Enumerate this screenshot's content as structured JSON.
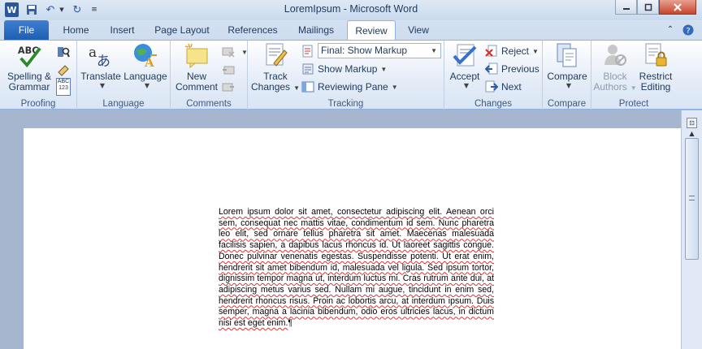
{
  "window": {
    "title": "LoremIpsum - Microsoft Word",
    "app_icon": "W"
  },
  "tabs": [
    {
      "label": "File"
    },
    {
      "label": "Home"
    },
    {
      "label": "Insert"
    },
    {
      "label": "Page Layout"
    },
    {
      "label": "References"
    },
    {
      "label": "Mailings"
    },
    {
      "label": "Review"
    },
    {
      "label": "View"
    }
  ],
  "active_tab": "Review",
  "ribbon": {
    "proofing": {
      "label": "Proofing",
      "spelling_line1": "Spelling &",
      "spelling_line2": "Grammar",
      "abc_small": "ABC",
      "num_small": "123"
    },
    "language": {
      "label": "Language",
      "translate": "Translate",
      "language": "Language"
    },
    "comments": {
      "label": "Comments",
      "new_comment_line1": "New",
      "new_comment_line2": "Comment"
    },
    "tracking": {
      "label": "Tracking",
      "track_changes_line1": "Track",
      "track_changes_line2": "Changes",
      "markup_select": "Final: Show Markup",
      "show_markup": "Show Markup",
      "reviewing_pane": "Reviewing Pane"
    },
    "changes": {
      "label": "Changes",
      "accept": "Accept",
      "reject": "Reject",
      "previous": "Previous",
      "next": "Next"
    },
    "compare": {
      "label": "Compare",
      "compare": "Compare"
    },
    "protect": {
      "label": "Protect",
      "block_authors_line1": "Block",
      "block_authors_line2": "Authors",
      "restrict_editing_line1": "Restrict",
      "restrict_editing_line2": "Editing"
    }
  },
  "document": {
    "text": "Lorem ipsum dolor sit amet, consectetur adipiscing elit. Aenean orci sem, consequat nec mattis vitae, condimentum id sem. Nunc pharetra leo elit, sed ornare tellus pharetra sit amet. Maecenas malesuada facilisis sapien, a dapibus lacus rhoncus id. Ut laoreet sagittis congue. Donec pulvinar venenatis egestas. Suspendisse potenti. Ut erat enim, hendrerit sit amet bibendum id, malesuada vel ligula. Sed ipsum tortor, dignissim tempor magna ut, interdum luctus mi. Cras rutrum ante dui, at adipiscing metus varius sed. Nullam mi augue, tincidunt in enim sed, hendrerit rhoncus risus. Proin ac lobortis arcu, at interdum ipsum. Duis semper, magna a lacinia bibendum, odio eros ultricies lacus, in dictum nisi est eget enim.",
    "pilcrow": "¶"
  },
  "colors": {
    "file_tab": "#2a6ac3",
    "ribbon_border": "#8db2e3",
    "doc_background": "#a6b6ce",
    "spell_underline": "#d33333"
  }
}
